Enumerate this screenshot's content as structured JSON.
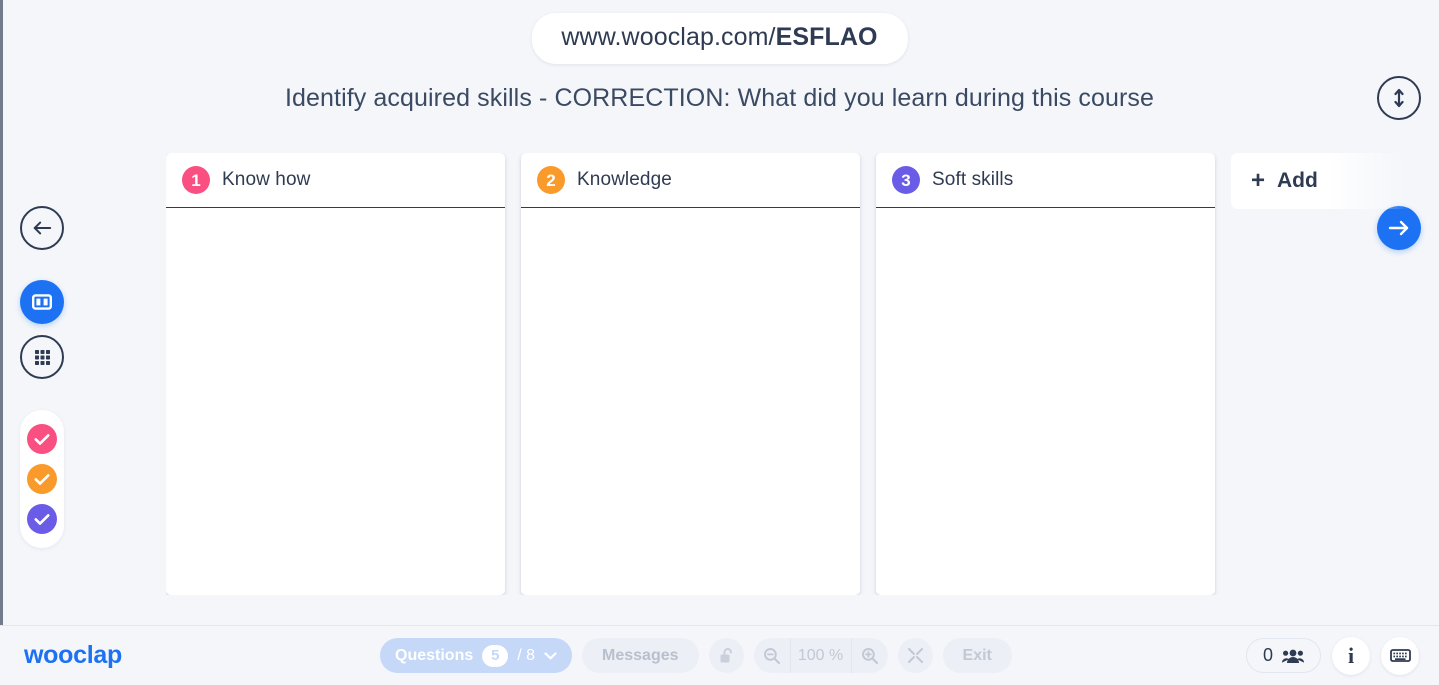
{
  "url_bar": {
    "prefix": "www.wooclap.com/",
    "code": "ESFLAO"
  },
  "question": {
    "title": "Identify acquired skills - CORRECTION: What did you learn during this course"
  },
  "top_right": {
    "resize_icon": "vertical-double-arrow-icon"
  },
  "navigation": {
    "next_icon": "arrow-right-icon",
    "back_icon": "arrow-left-icon"
  },
  "sidebar": {
    "items": [
      {
        "name": "back-button",
        "icon": "arrow-left-icon"
      },
      {
        "name": "board-view-button",
        "icon": "columns-view-icon",
        "active": true
      },
      {
        "name": "grid-view-button",
        "icon": "grid-view-icon",
        "active": false
      }
    ],
    "filters": [
      {
        "name": "filter-chip-1",
        "icon": "check-icon",
        "color": "#fa5081"
      },
      {
        "name": "filter-chip-2",
        "icon": "check-icon",
        "color": "#f99a2b"
      },
      {
        "name": "filter-chip-3",
        "icon": "check-icon",
        "color": "#6b5ce7"
      }
    ]
  },
  "board": {
    "columns": [
      {
        "number": "1",
        "title": "Know how",
        "color": "#fa5081"
      },
      {
        "number": "2",
        "title": "Knowledge",
        "color": "#f99a2b"
      },
      {
        "number": "3",
        "title": "Soft skills",
        "color": "#6b5ce7"
      }
    ],
    "add_column": {
      "plus": "+",
      "label": "Add"
    }
  },
  "footer": {
    "brand": "wooclap",
    "questions": {
      "label": "Questions",
      "current": "5",
      "total": "/ 8",
      "chevron_icon": "chevron-down-icon"
    },
    "messages_label": "Messages",
    "lock_icon": "unlock-icon",
    "zoom": {
      "out_icon": "zoom-out-icon",
      "value": "100 %",
      "in_icon": "zoom-in-icon"
    },
    "fullscreen_icon": "fullscreen-icon",
    "exit_label": "Exit",
    "participants": {
      "count": "0",
      "icon": "people-icon"
    },
    "info_glyph": "i",
    "keyboard_icon": "keyboard-icon"
  }
}
